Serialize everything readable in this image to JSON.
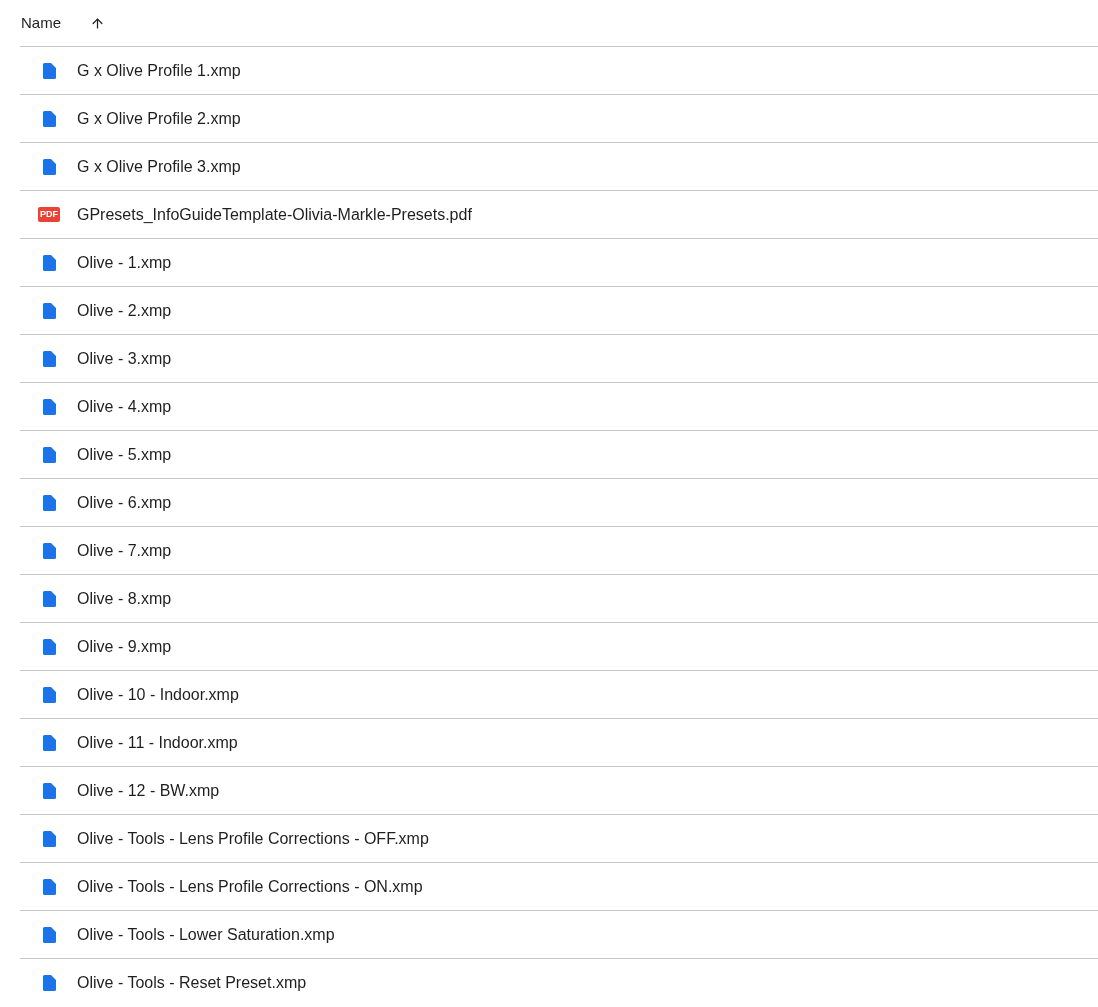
{
  "header": {
    "label": "Name",
    "ascending": true
  },
  "files": [
    {
      "name": "G x Olive Profile 1.xmp",
      "kind": "doc"
    },
    {
      "name": "G x Olive Profile 2.xmp",
      "kind": "doc"
    },
    {
      "name": "G x Olive Profile 3.xmp",
      "kind": "doc"
    },
    {
      "name": "GPresets_InfoGuideTemplate-Olivia-Markle-Presets.pdf",
      "kind": "pdf",
      "icon_label": "PDF"
    },
    {
      "name": "Olive - 1.xmp",
      "kind": "doc"
    },
    {
      "name": "Olive - 2.xmp",
      "kind": "doc"
    },
    {
      "name": "Olive - 3.xmp",
      "kind": "doc"
    },
    {
      "name": "Olive - 4.xmp",
      "kind": "doc"
    },
    {
      "name": "Olive - 5.xmp",
      "kind": "doc"
    },
    {
      "name": "Olive - 6.xmp",
      "kind": "doc"
    },
    {
      "name": "Olive - 7.xmp",
      "kind": "doc"
    },
    {
      "name": "Olive - 8.xmp",
      "kind": "doc"
    },
    {
      "name": "Olive - 9.xmp",
      "kind": "doc"
    },
    {
      "name": "Olive - 10 - Indoor.xmp",
      "kind": "doc"
    },
    {
      "name": "Olive - 11 - Indoor.xmp",
      "kind": "doc"
    },
    {
      "name": "Olive - 12 - BW.xmp",
      "kind": "doc"
    },
    {
      "name": "Olive - Tools - Lens Profile Corrections - OFF.xmp",
      "kind": "doc"
    },
    {
      "name": "Olive - Tools - Lens Profile Corrections - ON.xmp",
      "kind": "doc"
    },
    {
      "name": "Olive - Tools - Lower Saturation.xmp",
      "kind": "doc"
    },
    {
      "name": "Olive - Tools - Reset Preset.xmp",
      "kind": "doc"
    }
  ]
}
